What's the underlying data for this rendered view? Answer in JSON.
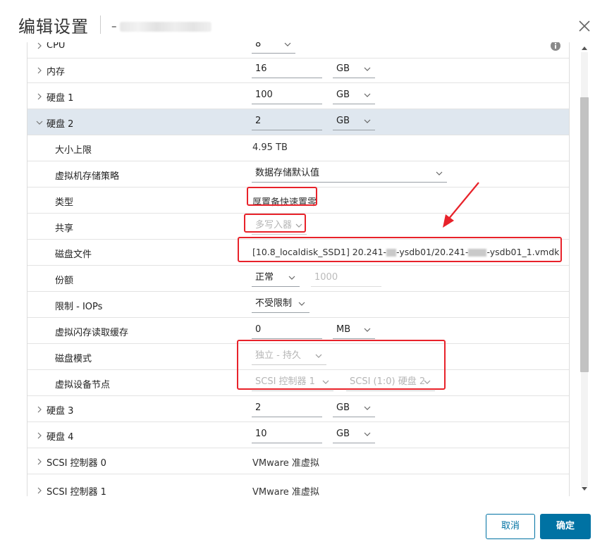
{
  "dialog": {
    "title": "编辑设置",
    "vm_name_prefix": "–"
  },
  "rows": {
    "cpu": {
      "label": "CPU",
      "value": "8"
    },
    "memory": {
      "label": "内存",
      "value": "16",
      "unit": "GB"
    },
    "disk1": {
      "label": "硬盘 1",
      "value": "100",
      "unit": "GB"
    },
    "disk2": {
      "label": "硬盘 2",
      "value": "2",
      "unit": "GB"
    },
    "max_size": {
      "label": "大小上限",
      "value": "4.95 TB"
    },
    "vm_storage_policy": {
      "label": "虚拟机存储策略",
      "value": "数据存储默认值"
    },
    "type": {
      "label": "类型",
      "value": "厚置备快速置零"
    },
    "sharing": {
      "label": "共享",
      "value": "多写入器"
    },
    "disk_file": {
      "label": "磁盘文件",
      "value_prefix": "[10.8_localdisk_SSD1] 20.241-",
      "value_mid": "-ysdb01/20.241-",
      "value_suffix": "-ysdb01_1.vmdk"
    },
    "shares": {
      "label": "份额",
      "value": "正常",
      "placeholder": "1000"
    },
    "limit_iops": {
      "label": "限制 - IOPs",
      "value": "不受限制"
    },
    "flash_cache": {
      "label": "虚拟闪存读取缓存",
      "value": "0",
      "unit": "MB"
    },
    "disk_mode": {
      "label": "磁盘模式",
      "value": "独立 - 持久"
    },
    "virtual_device_node": {
      "label": "虚拟设备节点",
      "controller": "SCSI 控制器 1",
      "node": "SCSI (1:0) 硬盘 2"
    },
    "disk3": {
      "label": "硬盘 3",
      "value": "2",
      "unit": "GB"
    },
    "disk4": {
      "label": "硬盘 4",
      "value": "10",
      "unit": "GB"
    },
    "scsi0": {
      "label": "SCSI 控制器 0",
      "value": "VMware 准虚拟"
    },
    "scsi1": {
      "label": "SCSI 控制器 1",
      "value": "VMware 准虚拟"
    }
  },
  "buttons": {
    "cancel": "取消",
    "ok": "确定"
  },
  "colors": {
    "accent": "#0072a3",
    "annotation_red": "#e8222a",
    "selected_row": "#dfe7ef"
  }
}
